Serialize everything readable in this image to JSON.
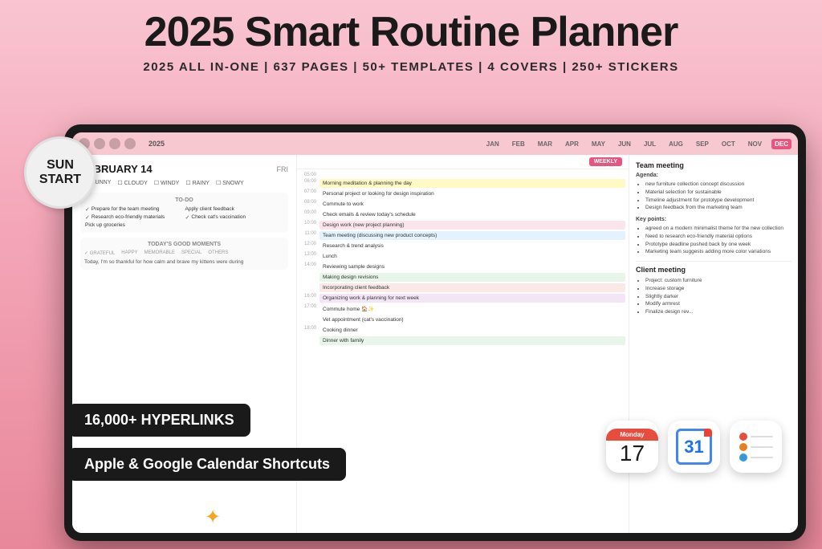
{
  "header": {
    "main_title": "2025 Smart Routine Planner",
    "subtitle": "2025 ALL IN-ONE  |  637 PAGES  |  50+ TEMPLATES  |  4 COVERS  |  250+ STICKERS"
  },
  "badge": {
    "line1": "SUN",
    "line2": "START"
  },
  "tablet": {
    "topbar": {
      "year": "2025",
      "months": [
        "JAN",
        "FEB",
        "MAR",
        "APR",
        "MAY",
        "JUN",
        "JUL",
        "AUG",
        "SEP",
        "OCT",
        "NOV",
        "DEC"
      ],
      "active_month": "DEC"
    },
    "left_panel": {
      "date": "FEBRUARY 14",
      "day": "FRI",
      "weather": [
        "SUNNY",
        "CLOUDY",
        "WINDY",
        "RAINY",
        "SNOWY"
      ],
      "todo_section_label": "To-do",
      "todos": [
        "Prepare for the team meeting",
        "Research eco-friendly materials",
        "Pick up groceries",
        "Apply client feedback",
        "Check cat's vaccination"
      ],
      "good_moments_label": "TODAY'S GOOD MOMENTS",
      "moments_cats": [
        "GRATEFUL",
        "HAPPY",
        "MEMORABLE",
        "SPECIAL",
        "OTHERS"
      ],
      "moments_text": "Today, I'm so thankful for how calm and brave my kittens were during"
    },
    "weekly": {
      "badge": "WEEKLY",
      "events": [
        {
          "time": "05:00",
          "text": "",
          "style": "plain"
        },
        {
          "time": "06:00",
          "text": "Morning meditation & planning the day",
          "style": "yellow"
        },
        {
          "time": "07:00",
          "text": "Personal project or looking for design inspiration",
          "style": "plain"
        },
        {
          "time": "08:00",
          "text": "Commute to work",
          "style": "plain"
        },
        {
          "time": "09:00",
          "text": "Check emails & review today's schedule",
          "style": "plain"
        },
        {
          "time": "10:00",
          "text": "Design work (new project planning)",
          "style": "pink"
        },
        {
          "time": "11:00",
          "text": "Team meeting (discussing new product concepts)",
          "style": "blue"
        },
        {
          "time": "12:00",
          "text": "Research & trend analysis",
          "style": "plain"
        },
        {
          "time": "13:00",
          "text": "Lunch",
          "style": "plain"
        },
        {
          "time": "14:00",
          "text": "Reviewing sample designs",
          "style": "plain"
        },
        {
          "time": "",
          "text": "Making design revisions",
          "style": "green"
        },
        {
          "time": "",
          "text": "Incorporating client feedback",
          "style": "peach"
        },
        {
          "time": "16:00",
          "text": "Organizing work & planning for next week",
          "style": "lavender"
        },
        {
          "time": "17:00",
          "text": "Commute home 🏠✨",
          "style": "plain"
        },
        {
          "time": "",
          "text": "Vet appointment (cat's vaccination)",
          "style": "plain"
        },
        {
          "time": "18:00",
          "text": "Cooking dinner",
          "style": "plain"
        },
        {
          "time": "",
          "text": "Dinner with family",
          "style": "green"
        }
      ]
    },
    "right_panel": {
      "team_meeting_title": "Team meeting",
      "agenda_label": "Agenda:",
      "agenda_items": [
        "new furniture collection concept discussion",
        "Material selection for sustainable",
        "Timeline adjustment for prototype development",
        "Design feedback from the marketing team"
      ],
      "key_points_label": "Key points:",
      "key_points": [
        "agreed on a modern minimalist theme for the new collection",
        "Need to research eco-friendly material options",
        "Prototype deadline pushed back by one week",
        "Marketing team suggests adding more color variations"
      ],
      "client_meeting_title": "Client meeting",
      "client_items": [
        "Project: custom furniture",
        "Increase storage",
        "Slightly darker",
        "Modify armrest",
        "Finalize design rev..."
      ]
    }
  },
  "overlays": {
    "hyperlinks_label": "16,000+ HYPERLINKS",
    "calendar_shortcuts_label": "Apple & Google Calendar Shortcuts"
  },
  "app_icons": {
    "apple_cal": {
      "day_name": "Monday",
      "day_number": "17"
    },
    "google_cal": {
      "day_number": "31"
    }
  }
}
